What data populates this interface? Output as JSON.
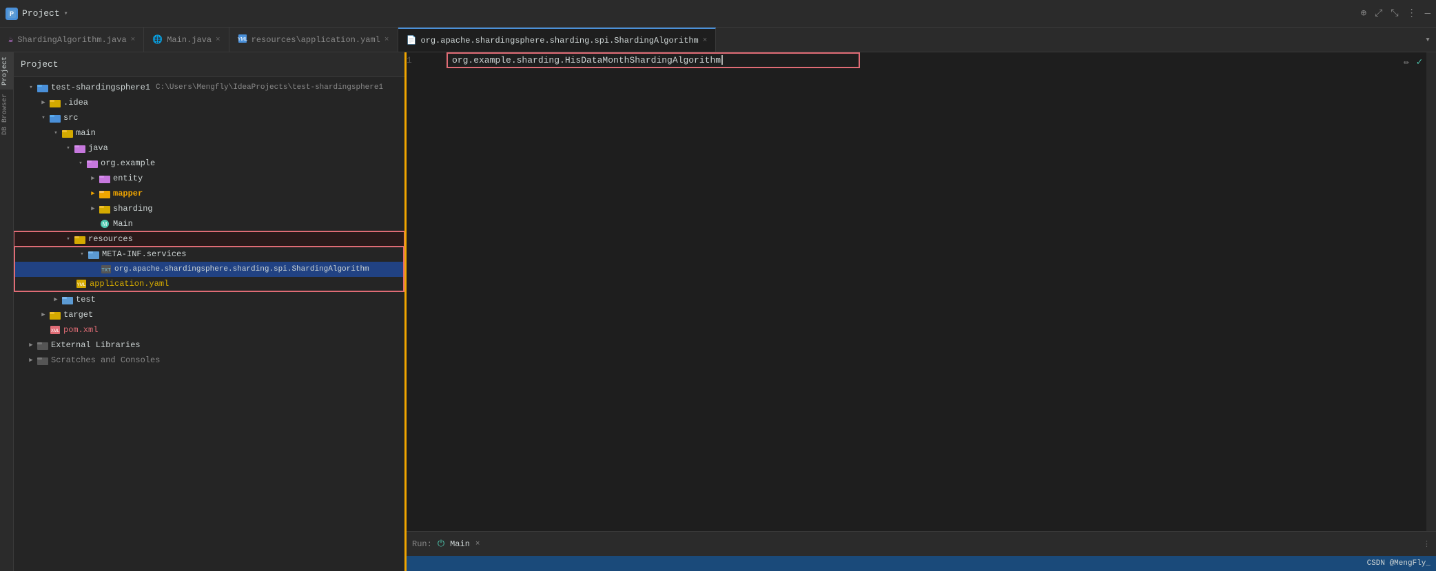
{
  "titleBar": {
    "projectIcon": "P",
    "title": "Project",
    "controls": [
      "⊕",
      "⤢",
      "⤡",
      "⋮",
      "—"
    ]
  },
  "tabs": [
    {
      "id": "shardingAlgorithmJava",
      "label": "ShardingAlgorithm.java",
      "icon": "☕",
      "active": false,
      "color": "#c678dd"
    },
    {
      "id": "mainJava",
      "label": "Main.java",
      "icon": "🌐",
      "active": false,
      "color": "#4ec9b0"
    },
    {
      "id": "applicationYaml",
      "label": "resources\\application.yaml",
      "icon": "📄",
      "active": false,
      "color": "#d4aa00"
    },
    {
      "id": "shardingAlgorithmSpi",
      "label": "org.apache.shardingsphere.sharding.spi.ShardingAlgorithm",
      "icon": "📄",
      "active": true,
      "color": "#7ec8e3"
    }
  ],
  "projectPanel": {
    "title": "Project",
    "rootName": "test-shardingsphere1",
    "rootPath": "C:\\Users\\Mengfly\\IdeaProjects\\test-shardingsphere1"
  },
  "tree": {
    "items": [
      {
        "id": "root",
        "label": "test-shardingsphere1",
        "subLabel": "C:\\Users\\Mengfly\\IdeaProjects\\test-shardingsphere1",
        "indent": 0,
        "expanded": true,
        "icon": "folder",
        "iconColor": "#4a90d9"
      },
      {
        "id": "idea",
        "label": ".idea",
        "indent": 1,
        "expanded": false,
        "icon": "folder",
        "iconColor": "#d4aa00"
      },
      {
        "id": "src",
        "label": "src",
        "indent": 1,
        "expanded": true,
        "icon": "folder",
        "iconColor": "#d4aa00"
      },
      {
        "id": "main",
        "label": "main",
        "indent": 2,
        "expanded": true,
        "icon": "folder",
        "iconColor": "#d4aa00"
      },
      {
        "id": "java",
        "label": "java",
        "indent": 3,
        "expanded": true,
        "icon": "folder-java",
        "iconColor": "#c678dd"
      },
      {
        "id": "orgExample",
        "label": "org.example",
        "indent": 4,
        "expanded": true,
        "icon": "folder-pkg",
        "iconColor": "#c678dd"
      },
      {
        "id": "entity",
        "label": "entity",
        "indent": 5,
        "expanded": false,
        "icon": "folder",
        "iconColor": "#d4aa00"
      },
      {
        "id": "mapper",
        "label": "mapper",
        "indent": 5,
        "expanded": false,
        "icon": "folder",
        "iconColor": "#f0a500",
        "bold": true
      },
      {
        "id": "sharding",
        "label": "sharding",
        "indent": 5,
        "expanded": false,
        "icon": "folder",
        "iconColor": "#d4aa00"
      },
      {
        "id": "mainClass",
        "label": "Main",
        "indent": 5,
        "expanded": false,
        "icon": "class",
        "iconColor": "#4ec9b0"
      },
      {
        "id": "resources",
        "label": "resources",
        "indent": 3,
        "expanded": true,
        "icon": "folder-res",
        "iconColor": "#d4aa00",
        "hasRedBox": true
      },
      {
        "id": "metaInfServices",
        "label": "META-INF.services",
        "indent": 4,
        "expanded": true,
        "icon": "folder-pkg",
        "iconColor": "#5c9bd4"
      },
      {
        "id": "spiFile",
        "label": "org.apache.shardingsphere.sharding.spi.ShardingAlgorithm",
        "indent": 5,
        "expanded": false,
        "icon": "file",
        "iconColor": "#7ec8e3"
      },
      {
        "id": "applicationYaml",
        "label": "application.yaml",
        "indent": 4,
        "expanded": false,
        "icon": "yaml",
        "iconColor": "#d4aa00"
      },
      {
        "id": "test",
        "label": "test",
        "indent": 2,
        "expanded": false,
        "icon": "folder",
        "iconColor": "#5c9bd4"
      },
      {
        "id": "target",
        "label": "target",
        "indent": 1,
        "expanded": false,
        "icon": "folder",
        "iconColor": "#d4aa00"
      },
      {
        "id": "pomXml",
        "label": "pom.xml",
        "indent": 1,
        "expanded": false,
        "icon": "xml",
        "iconColor": "#e06c75"
      },
      {
        "id": "externalLibs",
        "label": "External Libraries",
        "indent": 0,
        "expanded": false,
        "icon": "folder-ext",
        "iconColor": "#888"
      },
      {
        "id": "scratches",
        "label": "Scratches and Consoles",
        "indent": 0,
        "expanded": false,
        "icon": "folder",
        "iconColor": "#888"
      }
    ]
  },
  "editor": {
    "lineNumber": "1",
    "codeContent": "org.example.sharding.HisDataMonthShardingAlgorithm",
    "hasInputBox": true
  },
  "runBar": {
    "label": "Run:",
    "name": "Main",
    "closeSymbol": "×"
  },
  "statusBar": {
    "right": "CSDN @MengFly_"
  },
  "verticalLabels": [
    {
      "label": "Project",
      "active": true
    },
    {
      "label": "DB Browser",
      "active": false
    }
  ]
}
